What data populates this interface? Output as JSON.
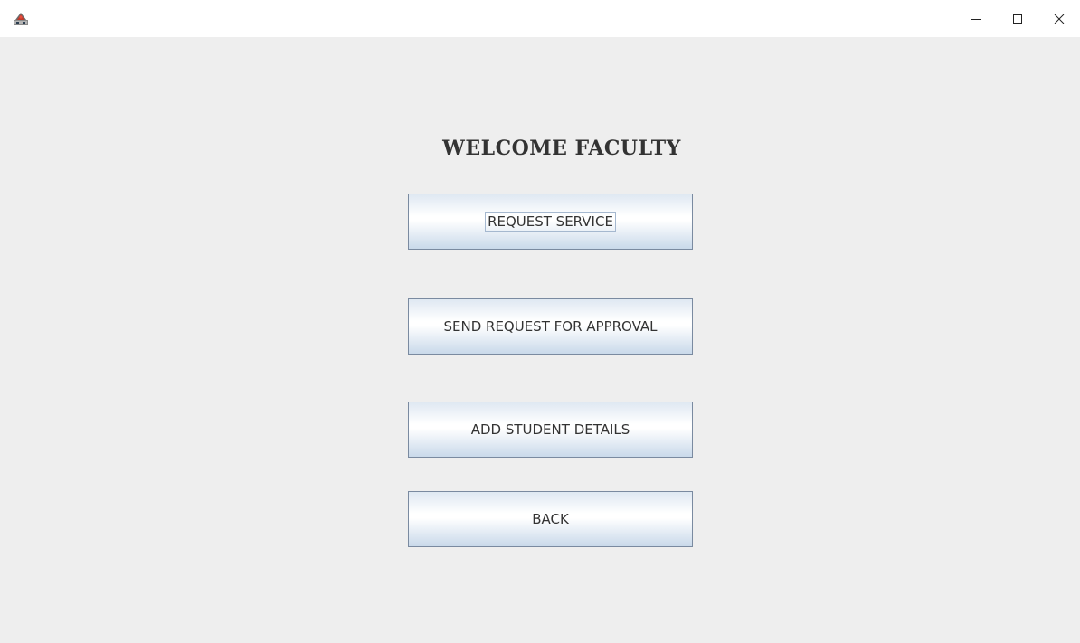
{
  "window": {
    "icon": "java-app-icon",
    "controls": {
      "minimize": "minimize-icon",
      "maximize": "maximize-icon",
      "close": "close-icon"
    }
  },
  "main": {
    "heading": "WELCOME FACULTY",
    "buttons": [
      {
        "label": "REQUEST SERVICE",
        "focused": true
      },
      {
        "label": "SEND REQUEST FOR APPROVAL",
        "focused": false
      },
      {
        "label": "ADD STUDENT DETAILS",
        "focused": false
      },
      {
        "label": "BACK",
        "focused": false
      }
    ]
  },
  "colors": {
    "background": "#eeeeee",
    "button_border": "#7a8aa0",
    "text": "#333333"
  }
}
